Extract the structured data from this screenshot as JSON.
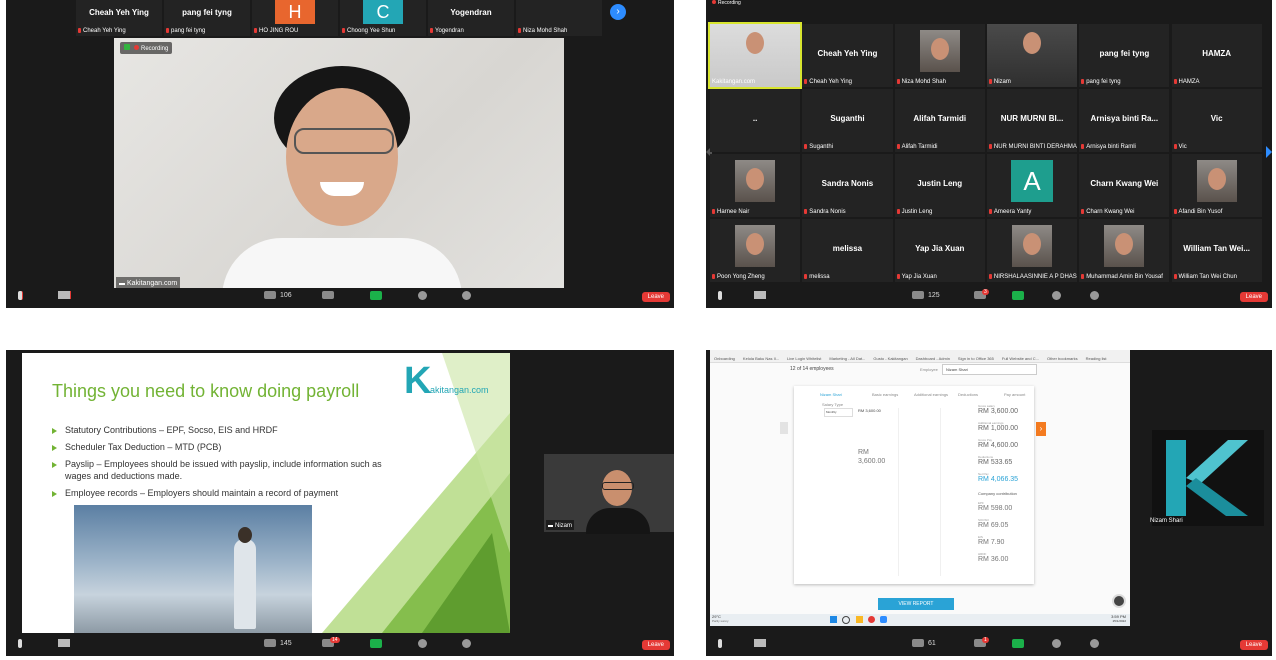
{
  "panel1": {
    "top_strip": [
      {
        "name": "Cheah Yeh Ying",
        "label": "Cheah Yeh Ying",
        "letter": ""
      },
      {
        "name": "pang fei tyng",
        "label": "pang fei tyng",
        "letter": ""
      },
      {
        "name": "",
        "label": "HO JING ROU",
        "letter": "H",
        "color": "#e8662e"
      },
      {
        "name": "",
        "label": "Choong Yee Shun",
        "letter": "C",
        "color": "#23a6b5"
      },
      {
        "name": "Yogendran",
        "label": "Yogendran",
        "letter": ""
      },
      {
        "name": "",
        "label": "Niza Mohd Shah",
        "letter": ""
      }
    ],
    "recording": "Recording",
    "speaker_label": "Kakitangan.com",
    "participants_count": "106",
    "leave": "Leave"
  },
  "panel2": {
    "recording": "Recording",
    "grid": [
      {
        "name": "",
        "label": "Kakitangan.com"
      },
      {
        "name": "Cheah Yeh Ying",
        "label": "Cheah Yeh Ying"
      },
      {
        "name": "",
        "label": "Niza Mohd Shah"
      },
      {
        "name": "",
        "label": "Nizam"
      },
      {
        "name": "pang fei tyng",
        "label": "pang fei tyng"
      },
      {
        "name": "HAMZA",
        "label": "HAMZA"
      },
      {
        "name": "..",
        "label": ""
      },
      {
        "name": "Suganthi",
        "label": "Suganthi"
      },
      {
        "name": "Alifah Tarmidi",
        "label": "Alifah Tarmidi"
      },
      {
        "name": "NUR MURNI BI...",
        "label": "NUR MURNI BINTI DERAHMAN"
      },
      {
        "name": "Arnisya binti Ra...",
        "label": "Arnisya binti Ramli"
      },
      {
        "name": "Vic",
        "label": "Vic"
      },
      {
        "name": "",
        "label": "Harnee Nair"
      },
      {
        "name": "Sandra Nonis",
        "label": "Sandra Nonis"
      },
      {
        "name": "Justin Leng",
        "label": "Justin Leng"
      },
      {
        "name": "",
        "label": "Ameera Yanty",
        "letter": "A"
      },
      {
        "name": "Charn Kwang Wei",
        "label": "Charn Kwang Wei"
      },
      {
        "name": "",
        "label": "Afandi Bin Yusof"
      },
      {
        "name": "",
        "label": "Poon Yong Zheng"
      },
      {
        "name": "melissa",
        "label": "melissa"
      },
      {
        "name": "Yap Jia Xuan",
        "label": "Yap Jia Xuan"
      },
      {
        "name": "",
        "label": "NIRSHALAASINNIE A P DHAS..."
      },
      {
        "name": "",
        "label": "Muhammad Amin Bin Yousaf"
      },
      {
        "name": "William Tan Wei...",
        "label": "William Tan Wei Chun"
      }
    ],
    "participants_count": "125",
    "chat_badge": "3",
    "leave": "Leave"
  },
  "panel3": {
    "slide": {
      "title": "Things you need to know doing payroll",
      "logo_text": "akitangan.com",
      "logo_letter": "K",
      "bullets": [
        "Statutory Contributions – EPF, Socso, EIS and HRDF",
        "Scheduler Tax Deduction – MTD (PCB)",
        "Payslip – Employees should be issued with payslip, include information such as",
        "wages and deductions made.",
        "Employee records – Employers should maintain a record of payment"
      ]
    },
    "speaker_label": "Nizam",
    "participants_count": "145",
    "chat_badge": "14",
    "leave": "Leave"
  },
  "panel4": {
    "bookmarks": [
      "Onboarding",
      "Kelola Baku Nas Il...",
      "Live Login Whitelist",
      "Marketing - All Dat...",
      "Gusto - Kakitangan",
      "Dashboard - Admin",
      "Sign in to Office 365",
      "Full Website and C...",
      "Other bookmarks",
      "Reading list"
    ],
    "page_count": "12 of 14 employees",
    "employee_label": "Employee",
    "employee_value": "Nizam Shari",
    "tabs": [
      "Nizam Shari",
      "Basic earnings",
      "Additional earnings",
      "Deductions",
      "Pay amount"
    ],
    "salary_type_label": "Salary Type",
    "salary_type": "Monthly",
    "basic_salary": "RM 3,600.00",
    "totals": [
      {
        "label": "Gross salary",
        "value": "RM 3,600.00"
      },
      {
        "label": "Additional earnings",
        "value": "RM 1,000.00"
      },
      {
        "label": "Gross Pay",
        "value": "RM 4,600.00"
      },
      {
        "label": "Deductions",
        "value": "RM 533.65"
      },
      {
        "label": "Net Pay",
        "value": "RM 4,066.35"
      }
    ],
    "company_contribution_label": "Company contribution",
    "contributions": [
      {
        "label": "EPF",
        "value": "RM 598.00"
      },
      {
        "label": "SOCSO",
        "value": "RM 69.05"
      },
      {
        "label": "EIS",
        "value": "RM 7.90"
      },
      {
        "label": "HRDF",
        "value": "RM 36.00"
      }
    ],
    "view_report": "VIEW REPORT",
    "taskbar_weather": "29°C",
    "taskbar_weather_sub": "Partly sunny",
    "taskbar_time": "3:59 PM",
    "taskbar_date": "25/1/2022",
    "speaker_label": "Nizam Shari",
    "participants_count": "61",
    "chat_badge": "1",
    "leave": "Leave"
  },
  "colors": {
    "zoom_bg": "#1a1a1a",
    "leave_red": "#e53935",
    "slide_green": "#72b334",
    "kakitangan_teal": "#23a6b5",
    "view_report_blue": "#2aa3d6"
  }
}
